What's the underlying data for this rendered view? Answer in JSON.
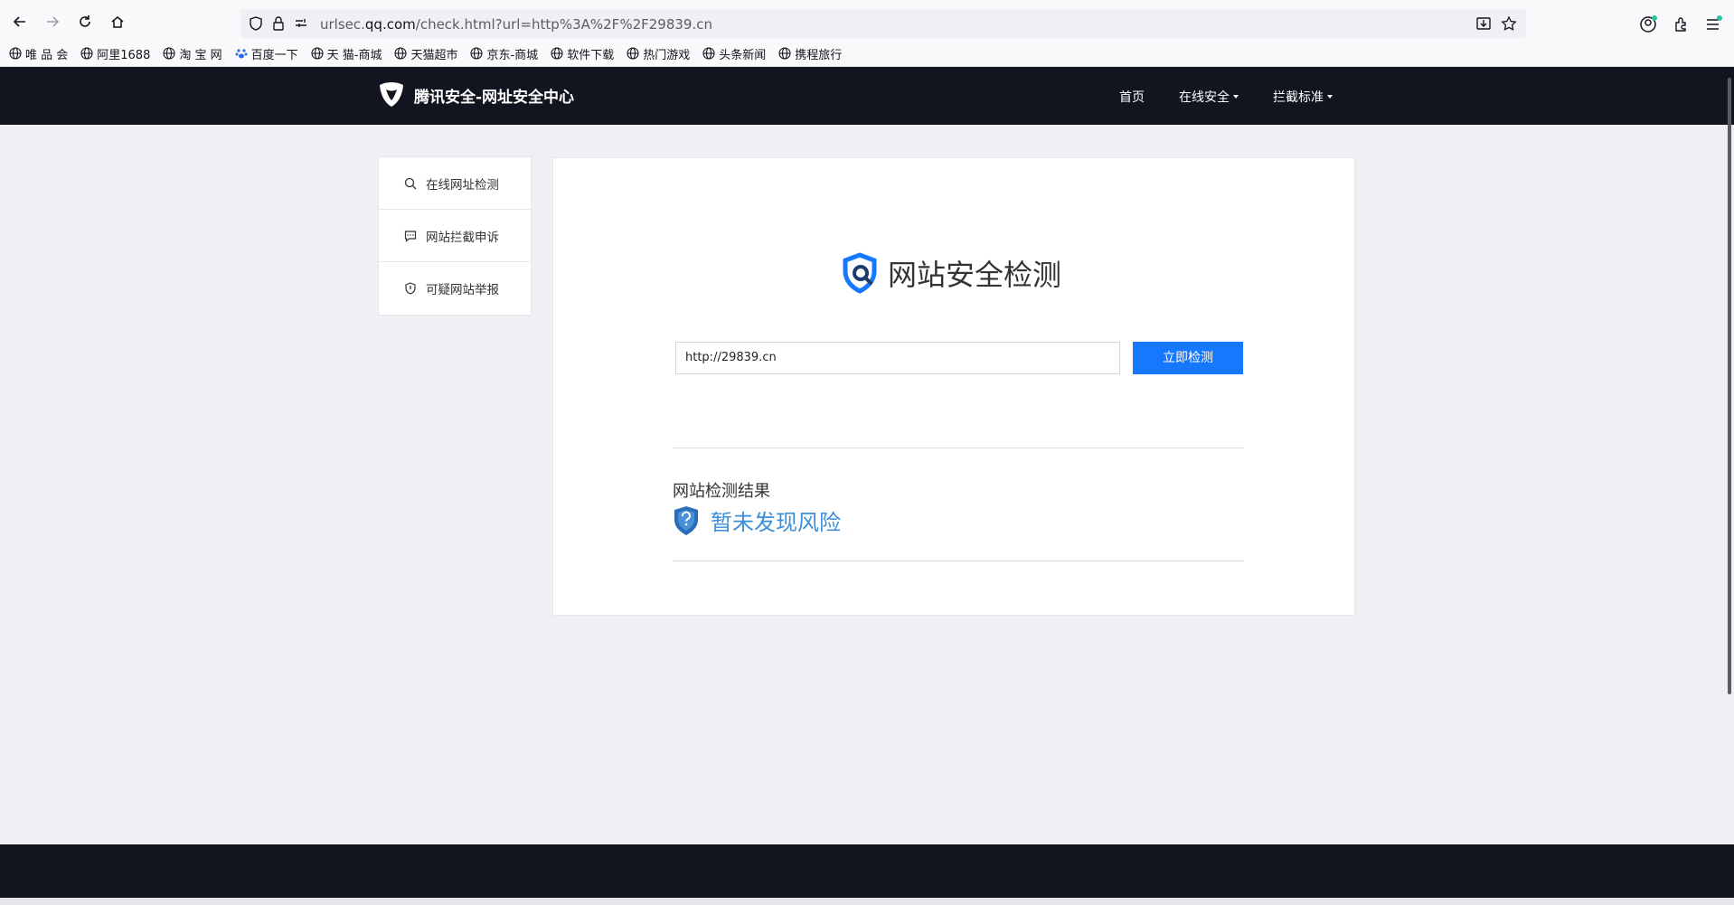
{
  "browser": {
    "url_prefix": "urlsec.",
    "url_host": "qq.com",
    "url_path": "/check.html?url=http%3A%2F%2F29839.cn"
  },
  "bookmarks": [
    {
      "label": "唯 品 会",
      "icon": "globe-icon"
    },
    {
      "label": "阿里1688",
      "icon": "globe-icon"
    },
    {
      "label": "淘 宝 网",
      "icon": "globe-icon"
    },
    {
      "label": "百度一下",
      "icon": "baidu-paw-icon"
    },
    {
      "label": "天 猫-商城",
      "icon": "globe-icon"
    },
    {
      "label": "天猫超市",
      "icon": "globe-icon"
    },
    {
      "label": "京东-商城",
      "icon": "globe-icon"
    },
    {
      "label": "软件下载",
      "icon": "globe-icon"
    },
    {
      "label": "热门游戏",
      "icon": "globe-icon"
    },
    {
      "label": "头条新闻",
      "icon": "globe-icon"
    },
    {
      "label": "携程旅行",
      "icon": "globe-icon"
    }
  ],
  "header": {
    "brand": "腾讯安全-网址安全中心",
    "nav": [
      {
        "label": "首页"
      },
      {
        "label": "在线安全"
      },
      {
        "label": "拦截标准"
      }
    ]
  },
  "sidebar": {
    "items": [
      {
        "label": "在线网址检测",
        "icon": "search-icon"
      },
      {
        "label": "网站拦截申诉",
        "icon": "message-icon"
      },
      {
        "label": "可疑网站举报",
        "icon": "shield-icon"
      }
    ]
  },
  "main": {
    "title": "网站安全检测",
    "input_value": "http://29839.cn",
    "check_button": "立即检测",
    "result_label": "网站检测结果",
    "result_text": "暂未发现风险"
  },
  "colors": {
    "header_bg": "#121520",
    "primary": "#1677ff",
    "result_text": "#3c8ed9"
  }
}
